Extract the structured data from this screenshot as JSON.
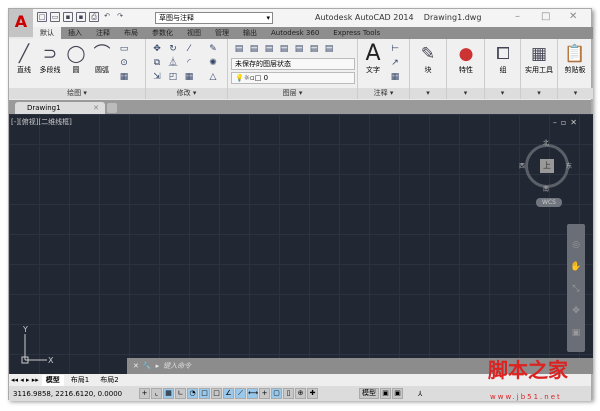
{
  "app": {
    "title": "Autodesk AutoCAD 2014",
    "document": "Drawing1.dwg",
    "logo": "A"
  },
  "workspace": "草图与注释",
  "ribbon_tabs": [
    "默认",
    "插入",
    "注释",
    "布局",
    "参数化",
    "视图",
    "管理",
    "输出",
    "Autodesk 360",
    "Express Tools"
  ],
  "panels": {
    "draw": {
      "label": "绘图 ▾",
      "buttons": [
        "直线",
        "多段线",
        "圆",
        "圆弧"
      ]
    },
    "modify": {
      "label": "修改 ▾"
    },
    "layers": {
      "label": "图层 ▾",
      "layer_state": "未保存的图层状态",
      "current_layer": "0"
    },
    "annotation": {
      "label": "注释 ▾",
      "text": "文字"
    },
    "block": {
      "label": "块"
    },
    "properties": {
      "label": "特性"
    },
    "groups": {
      "label": "组"
    },
    "utilities": {
      "label": "实用工具"
    },
    "clipboard": {
      "label": "剪贴板"
    }
  },
  "doc_tab": "Drawing1",
  "viewport_label": "[-][俯视][二维线框]",
  "viewcube": {
    "top": "上",
    "n": "北",
    "s": "南",
    "e": "东",
    "w": "西",
    "wcs": "WCS"
  },
  "command_placeholder": "键入命令",
  "layout_tabs": [
    "模型",
    "布局1",
    "布局2"
  ],
  "status": {
    "coords": "3116.9858, 2216.6120, 0.0000",
    "model": "模型"
  },
  "watermark": {
    "text": "脚本之家",
    "url": "www.jb51.net"
  }
}
